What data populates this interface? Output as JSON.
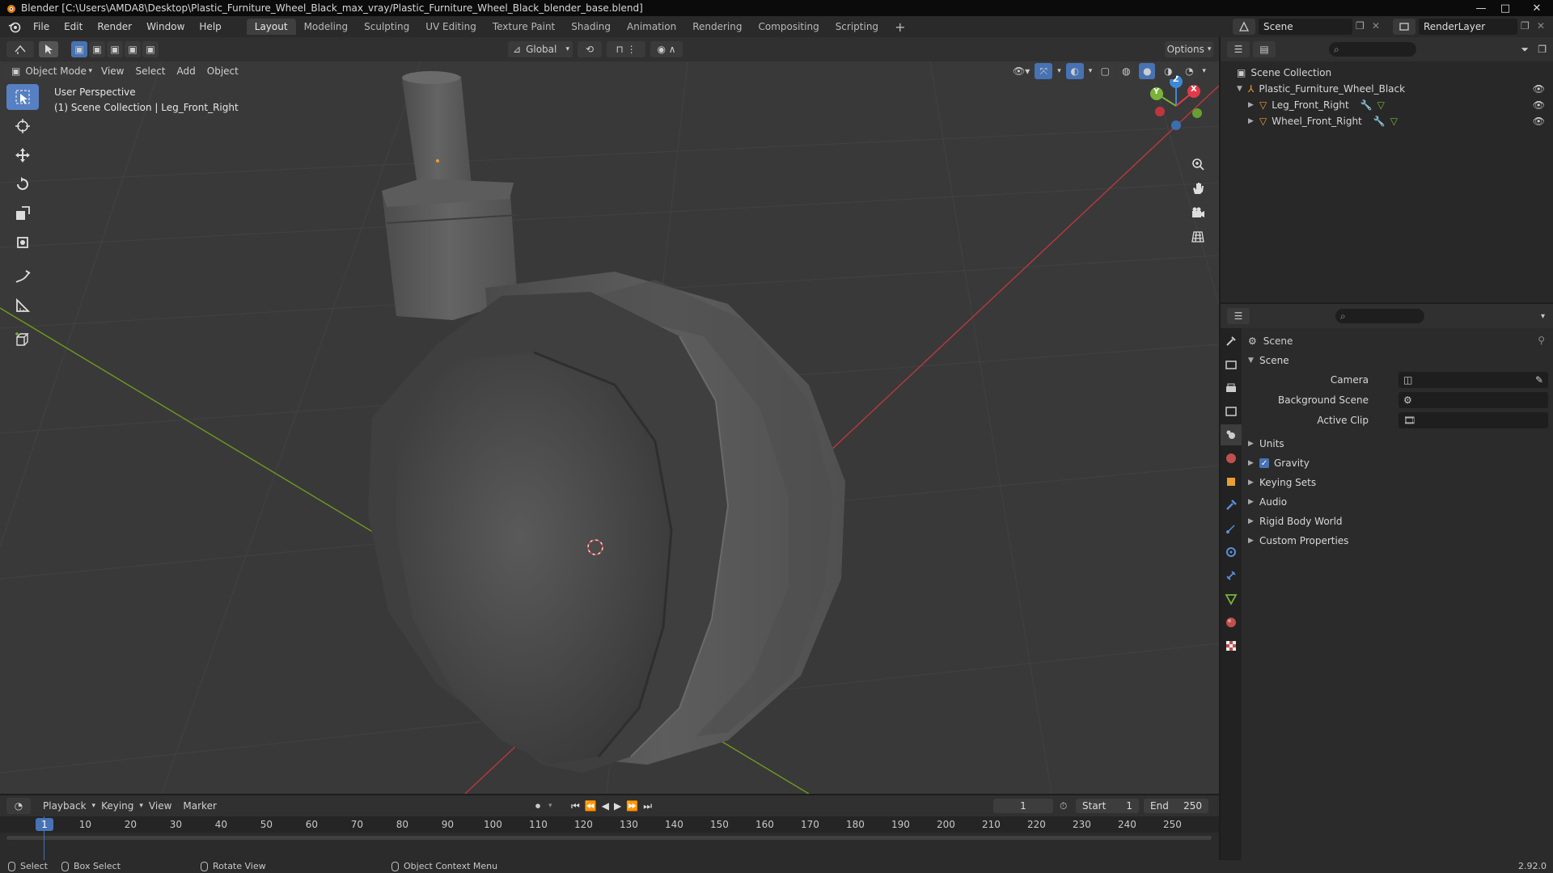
{
  "window": {
    "title": "Blender [C:\\Users\\AMDA8\\Desktop\\Plastic_Furniture_Wheel_Black_max_vray/Plastic_Furniture_Wheel_Black_blender_base.blend]",
    "minimize": "—",
    "maximize": "□",
    "close": "✕"
  },
  "menu": {
    "items": [
      "File",
      "Edit",
      "Render",
      "Window",
      "Help"
    ],
    "workspaces": [
      "Layout",
      "Modeling",
      "Sculpting",
      "UV Editing",
      "Texture Paint",
      "Shading",
      "Animation",
      "Rendering",
      "Compositing",
      "Scripting"
    ],
    "active_workspace": "Layout",
    "add_tab": "+",
    "scene_name": "Scene",
    "view_layer": "RenderLayer"
  },
  "viewport_header": {
    "mode": "Object Mode",
    "menus": [
      "View",
      "Select",
      "Add",
      "Object"
    ],
    "orientation": "Global",
    "options": "Options"
  },
  "viewport": {
    "info_line1": "User Perspective",
    "info_line2": "(1) Scene Collection | Leg_Front_Right",
    "background": "#393939",
    "grid_color": "#424242",
    "x_axis_color": "#b8393f",
    "y_axis_color": "#6f9a1f",
    "gizmo": {
      "x": "X",
      "y": "Y",
      "z": "Z",
      "x_color": "#e13a48",
      "y_color": "#7ab33a",
      "z_color": "#3f88d6"
    }
  },
  "toolbar": {
    "tools": [
      "select-box-icon",
      "cursor-icon",
      "move-icon",
      "rotate-icon",
      "scale-icon",
      "transform-icon",
      "annotate-icon",
      "measure-icon",
      "add-cube-icon"
    ],
    "active": "select-box-icon"
  },
  "outliner": {
    "root": "Scene Collection",
    "collection": "Plastic_Furniture_Wheel_Black",
    "objects": [
      "Leg_Front_Right",
      "Wheel_Front_Right"
    ]
  },
  "properties": {
    "context": "Scene",
    "panel": "Scene",
    "fields": [
      {
        "label": "Camera",
        "value": ""
      },
      {
        "label": "Background Scene",
        "value": ""
      },
      {
        "label": "Active Clip",
        "value": ""
      }
    ],
    "subpanels": [
      "Units",
      "Gravity",
      "Keying Sets",
      "Audio",
      "Rigid Body World",
      "Custom Properties"
    ],
    "gravity_checked": true,
    "accent": "#4772b3"
  },
  "timeline": {
    "menus": [
      "Playback",
      "Keying",
      "View",
      "Marker"
    ],
    "current_frame": "1",
    "start_label": "Start",
    "start": "1",
    "end_label": "End",
    "end": "250",
    "ticks": [
      "1",
      "10",
      "20",
      "30",
      "40",
      "50",
      "60",
      "70",
      "80",
      "90",
      "100",
      "110",
      "120",
      "130",
      "140",
      "150",
      "160",
      "170",
      "180",
      "190",
      "200",
      "210",
      "220",
      "230",
      "240",
      "250"
    ]
  },
  "statusbar": {
    "select": "Select",
    "box_select": "Box Select",
    "rotate_view": "Rotate View",
    "context_menu": "Object Context Menu",
    "version": "2.92.0"
  }
}
